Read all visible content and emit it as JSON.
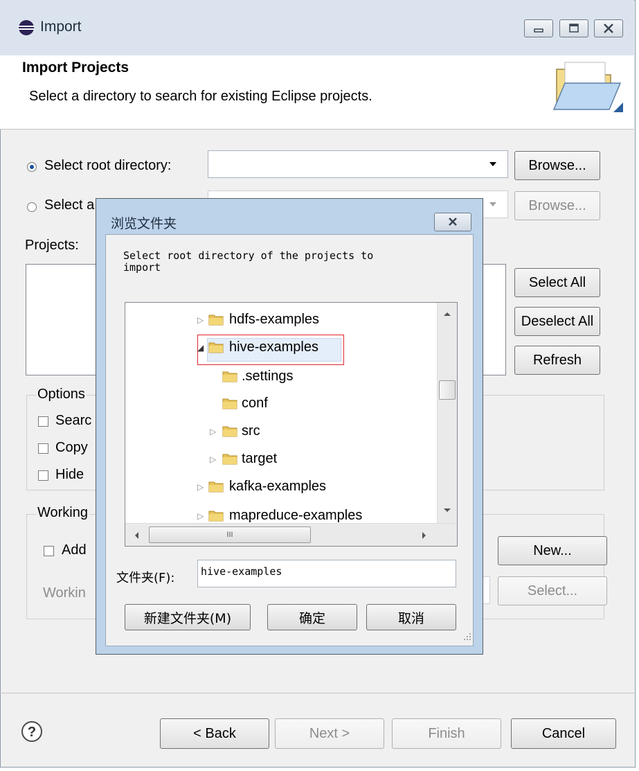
{
  "window": {
    "title": "Import"
  },
  "header": {
    "title": "Import Projects",
    "description": "Select a directory to search for existing Eclipse projects."
  },
  "source": {
    "root_dir_label": "Select root directory:",
    "root_dir_value": "",
    "archive_label_visible": "Select a",
    "browse_label": "Browse...",
    "browse_disabled_label": "Browse..."
  },
  "projects": {
    "label": "Projects:",
    "select_all": "Select All",
    "deselect_all": "Deselect All",
    "refresh": "Refresh"
  },
  "options": {
    "legend": "Options",
    "items": [
      "Searc",
      "Copy",
      "Hide "
    ]
  },
  "working_sets": {
    "legend": "Working",
    "add_label": "Add",
    "working_label": "Workin",
    "new_label": "New...",
    "select_label": "Select..."
  },
  "footer": {
    "back": "< Back",
    "next": "Next >",
    "finish": "Finish",
    "cancel": "Cancel"
  },
  "browse_dialog": {
    "title": "浏览文件夹",
    "instruction_line1": "Select root directory of the projects to",
    "instruction_line2": "import",
    "tree": [
      {
        "label": "hdfs-examples",
        "expander": "▷",
        "selected": false
      },
      {
        "label": "hive-examples",
        "expander": "◢",
        "selected": true
      },
      {
        "label": ".settings",
        "expander": "",
        "selected": false
      },
      {
        "label": "conf",
        "expander": "",
        "selected": false
      },
      {
        "label": "src",
        "expander": "▷",
        "selected": false
      },
      {
        "label": "target",
        "expander": "▷",
        "selected": false
      },
      {
        "label": "kafka-examples",
        "expander": "▷",
        "selected": false
      },
      {
        "label": "mapreduce-examples",
        "expander": "▷",
        "selected": false
      }
    ],
    "hscroll_grip": "III",
    "folder_label": "文件夹(F):",
    "folder_value": "hive-examples",
    "new_folder": "新建文件夹(M)",
    "ok": "确定",
    "cancel": "取消"
  },
  "colors": {
    "titlebar": "#dbe4ee",
    "dialog_frame": "#bcd3ea",
    "selection_outline": "#e0262b"
  }
}
